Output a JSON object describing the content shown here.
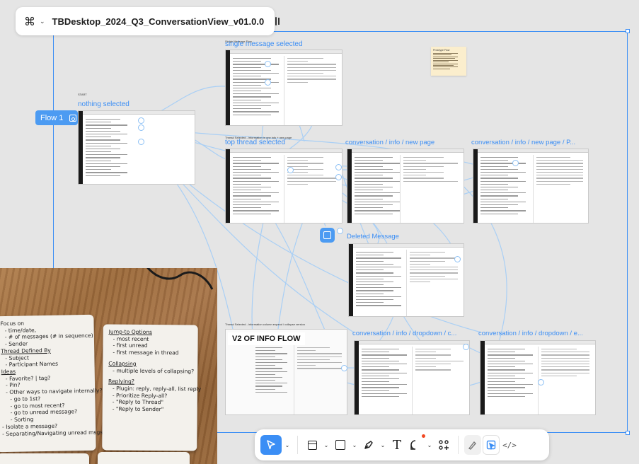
{
  "file": {
    "name": "TBDesktop_2024_Q3_ConversationView_v01.0.0",
    "logo_icon": "figma-logo-icon",
    "menu_caret": "⌄"
  },
  "canvas": {
    "start_label": "START",
    "nothing_selected": "nothing selected",
    "flow_chip": "Flow 1",
    "single_flow_small": "Single Message Flow",
    "single_selected": "single message selected",
    "thread_small": "Thread Selected - information in one info + new page",
    "top_thread": "top thread selected",
    "conv_info_new": "conversation / info / new page",
    "conv_info_new_p": "conversation / info / new page / P...",
    "deleted_message": "Deleted Message",
    "thread_small_2": "Thread Selected - information column expand / collapse version",
    "v2_title": "V2 OF INFO FLOW",
    "conv_dropdown_c": "conversation / info / dropdown / c...",
    "conv_dropdown_e": "conversation / info / dropdown / e...",
    "sticky_title": "Prototype Flow"
  },
  "photo_notes": {
    "card1": [
      "Focus on",
      "- time/date,",
      "- # of messages (# in sequence)",
      "- Sender",
      "Thread Defined By",
      "- Subject",
      "- Participant Names",
      "Ideas",
      "- Favorite?  | tag?",
      "- Pin?",
      "- Other ways to navigate internally?",
      "- go to 1st?",
      "- go to most recent?",
      "- go to unread message?",
      "- Sorting",
      "- Isolate a message?",
      "- Separating/Navigating unread msgs?"
    ],
    "card2": [
      "Jump-to Options",
      "- most recent",
      "- first unread",
      "- first message in thread",
      "Collapsing",
      "- multiple levels of collapsing?",
      "Replying?",
      "- Plugin: reply, reply-all, list reply",
      "- Prioritize Reply-all?",
      "- \"Reply to Thread\"",
      "- \"Reply to Sender\""
    ]
  },
  "toolbar": {
    "tools": [
      {
        "name": "move-tool",
        "icon": "cursor-icon",
        "active": true
      },
      {
        "name": "frame-tool",
        "icon": "frame-icon"
      },
      {
        "name": "shape-tool",
        "icon": "rectangle-icon"
      },
      {
        "name": "pen-tool",
        "icon": "pen-icon"
      },
      {
        "name": "text-tool",
        "icon": "text-icon",
        "glyph": "T"
      },
      {
        "name": "comment-tool",
        "icon": "comment-icon"
      },
      {
        "name": "actions-tool",
        "icon": "actions-icon"
      }
    ],
    "right": [
      {
        "name": "draw-mode",
        "icon": "draw-icon"
      },
      {
        "name": "design-mode",
        "icon": "design-icon",
        "active": true
      },
      {
        "name": "dev-mode",
        "icon": "dev-mode-icon",
        "glyph": "</>"
      }
    ],
    "colors": {
      "accent": "#3b8ef5",
      "comment_dot": "#f24822"
    }
  }
}
